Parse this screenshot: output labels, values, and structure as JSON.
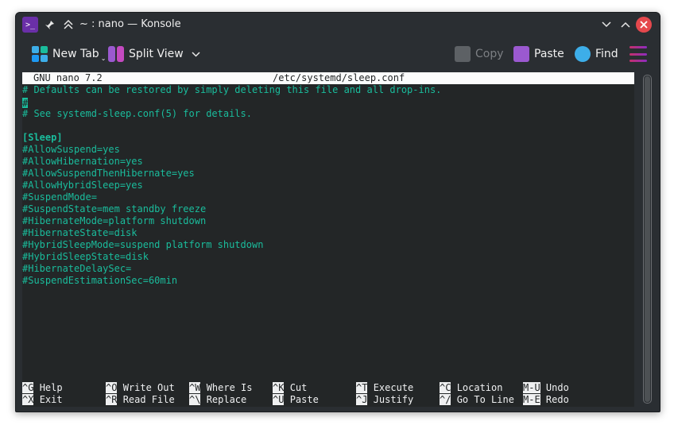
{
  "window": {
    "title": "~ : nano — Konsole",
    "app_icon_glyph": ">_",
    "accent": "#6a2fa8",
    "close_color": "#e5484d"
  },
  "toolbar": {
    "new_tab": "New Tab",
    "split_view": "Split View",
    "copy": "Copy",
    "paste": "Paste",
    "find": "Find"
  },
  "editor": {
    "program": "GNU nano 7.2",
    "filename": "/etc/systemd/sleep.conf",
    "text_color": "#1abc9c",
    "lines": [
      "# Defaults can be restored by simply deleting this file and all drop-ins.",
      "#",
      "# See systemd-sleep.conf(5) for details.",
      "",
      "[Sleep]",
      "#AllowSuspend=yes",
      "#AllowHibernation=yes",
      "#AllowSuspendThenHibernate=yes",
      "#AllowHybridSleep=yes",
      "#SuspendMode=",
      "#SuspendState=mem standby freeze",
      "#HibernateMode=platform shutdown",
      "#HibernateState=disk",
      "#HybridSleepMode=suspend platform shutdown",
      "#HybridSleepState=disk",
      "#HibernateDelaySec=",
      "#SuspendEstimationSec=60min"
    ]
  },
  "shortcuts": {
    "row1": [
      {
        "key": "^G",
        "label": "Help"
      },
      {
        "key": "^O",
        "label": "Write Out"
      },
      {
        "key": "^W",
        "label": "Where Is"
      },
      {
        "key": "^K",
        "label": "Cut"
      },
      {
        "key": "^T",
        "label": "Execute"
      },
      {
        "key": "^C",
        "label": "Location"
      },
      {
        "key": "M-U",
        "label": "Undo"
      }
    ],
    "row2": [
      {
        "key": "^X",
        "label": "Exit"
      },
      {
        "key": "^R",
        "label": "Read File"
      },
      {
        "key": "^\\",
        "label": "Replace"
      },
      {
        "key": "^U",
        "label": "Paste"
      },
      {
        "key": "^J",
        "label": "Justify"
      },
      {
        "key": "^/",
        "label": "Go To Line"
      },
      {
        "key": "M-E",
        "label": "Redo"
      }
    ]
  }
}
